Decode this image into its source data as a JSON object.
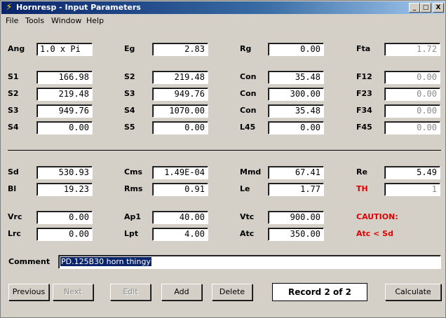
{
  "window": {
    "title": "Hornresp - Input Parameters",
    "controls": [
      "_",
      "□",
      "X"
    ]
  },
  "menu": [
    "File",
    "Tools",
    "Window",
    "Help"
  ],
  "labels": {
    "ang": "Ang",
    "eg": "Eg",
    "rg": "Rg",
    "fta": "Fta",
    "s1": "S1",
    "s2a": "S2",
    "con1": "Con",
    "f12": "F12",
    "s2b": "S2",
    "s3a": "S3",
    "con2": "Con",
    "f23": "F23",
    "s3b": "S3",
    "s4a": "S4",
    "con3": "Con",
    "f34": "F34",
    "s4b": "S4",
    "s5": "S5",
    "l45": "L45",
    "f45": "F45",
    "sd": "Sd",
    "cms": "Cms",
    "mmd": "Mmd",
    "re": "Re",
    "bl": "Bl",
    "rms": "Rms",
    "le": "Le",
    "th": "TH",
    "vrc": "Vrc",
    "ap1": "Ap1",
    "vtc": "Vtc",
    "caution": "CAUTION:",
    "lrc": "Lrc",
    "lpt": "Lpt",
    "atc": "Atc",
    "warning": "Atc < Sd",
    "comment": "Comment"
  },
  "values": {
    "ang": "1.0 x Pi",
    "eg": "2.83",
    "rg": "0.00",
    "fta": "1.72",
    "s1": "166.98",
    "s2a": "219.48",
    "con1": "35.48",
    "f12": "0.00",
    "s2b": "219.48",
    "s3a": "949.76",
    "con2": "300.00",
    "f23": "0.00",
    "s3b": "949.76",
    "s4a": "1070.00",
    "con3": "35.48",
    "f34": "0.00",
    "s4b": "0.00",
    "s5": "0.00",
    "l45": "0.00",
    "f45": "0.00",
    "sd": "530.93",
    "cms": "1.49E-04",
    "mmd": "67.41",
    "re": "5.49",
    "bl": "19.23",
    "rms": "0.91",
    "le": "1.77",
    "th": "1",
    "vrc": "0.00",
    "ap1": "40.00",
    "vtc": "900.00",
    "lrc": "0.00",
    "lpt": "4.00",
    "atc": "350.00"
  },
  "comment": "PD.125B30 horn thingy",
  "buttons": {
    "previous": "Previous",
    "next": "Next",
    "edit": "Edit",
    "add": "Add",
    "delete": "Delete",
    "calculate": "Calculate"
  },
  "record": "Record 2 of 2",
  "colors": {
    "titlebar": "#0a246a",
    "warning": "#e00000",
    "disabled": "#8a8a8a"
  }
}
